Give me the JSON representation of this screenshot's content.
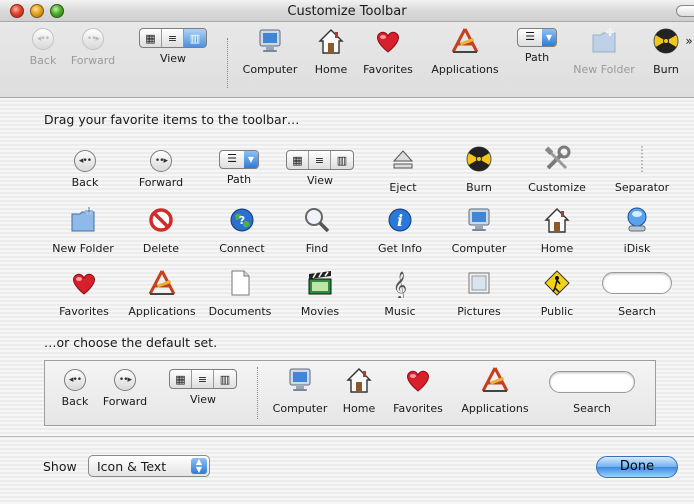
{
  "window": {
    "title": "Customize Toolbar"
  },
  "toolbar": {
    "items": [
      {
        "label": "Back",
        "icon": "back-arrow-icon",
        "disabled": true
      },
      {
        "label": "Forward",
        "icon": "forward-arrow-icon",
        "disabled": true
      },
      {
        "label": "View",
        "icon": "view-buttons-icon"
      },
      {
        "label": "Computer",
        "icon": "computer-icon"
      },
      {
        "label": "Home",
        "icon": "home-icon"
      },
      {
        "label": "Favorites",
        "icon": "heart-icon"
      },
      {
        "label": "Applications",
        "icon": "applications-icon"
      },
      {
        "label": "Path",
        "icon": "path-popup-icon"
      },
      {
        "label": "New Folder",
        "icon": "new-folder-icon",
        "disabled": true
      },
      {
        "label": "Burn",
        "icon": "burn-icon"
      }
    ]
  },
  "instructions": {
    "drag": "Drag your favorite items to the toolbar…",
    "default": "…or choose the default set."
  },
  "palette": [
    [
      {
        "label": "Back",
        "icon": "back-arrow-icon"
      },
      {
        "label": "Forward",
        "icon": "forward-arrow-icon"
      },
      {
        "label": "Path",
        "icon": "path-popup-icon"
      },
      {
        "label": "View",
        "icon": "view-buttons-icon"
      },
      {
        "label": "Eject",
        "icon": "eject-icon"
      },
      {
        "label": "Burn",
        "icon": "burn-icon"
      },
      {
        "label": "Customize",
        "icon": "tools-icon"
      },
      {
        "label": "Separator",
        "icon": "separator-icon"
      }
    ],
    [
      {
        "label": "New Folder",
        "icon": "new-folder-icon"
      },
      {
        "label": "Delete",
        "icon": "delete-icon"
      },
      {
        "label": "Connect",
        "icon": "globe-icon"
      },
      {
        "label": "Find",
        "icon": "magnifier-icon"
      },
      {
        "label": "Get Info",
        "icon": "info-icon"
      },
      {
        "label": "Computer",
        "icon": "computer-icon"
      },
      {
        "label": "Home",
        "icon": "home-icon"
      },
      {
        "label": "iDisk",
        "icon": "idisk-icon"
      }
    ],
    [
      {
        "label": "Favorites",
        "icon": "heart-icon"
      },
      {
        "label": "Applications",
        "icon": "applications-icon"
      },
      {
        "label": "Documents",
        "icon": "document-icon"
      },
      {
        "label": "Movies",
        "icon": "clapperboard-icon"
      },
      {
        "label": "Music",
        "icon": "music-note-icon"
      },
      {
        "label": "Pictures",
        "icon": "picture-frame-icon"
      },
      {
        "label": "Public",
        "icon": "public-sign-icon"
      },
      {
        "label": "Search",
        "icon": "search-field-icon"
      }
    ]
  ],
  "default_set": [
    {
      "label": "Back",
      "icon": "back-arrow-icon"
    },
    {
      "label": "Forward",
      "icon": "forward-arrow-icon"
    },
    {
      "label": "View",
      "icon": "view-buttons-icon"
    },
    {
      "label": "Computer",
      "icon": "computer-icon"
    },
    {
      "label": "Home",
      "icon": "home-icon"
    },
    {
      "label": "Favorites",
      "icon": "heart-icon"
    },
    {
      "label": "Applications",
      "icon": "applications-icon"
    },
    {
      "label": "Search",
      "icon": "search-field-icon"
    }
  ],
  "footer": {
    "show_label": "Show",
    "show_value": "Icon & Text",
    "done_label": "Done"
  },
  "colors": {
    "accent_blue": "#3d8be0",
    "heart_red": "#d8202c",
    "window_bg": "#ececec"
  }
}
